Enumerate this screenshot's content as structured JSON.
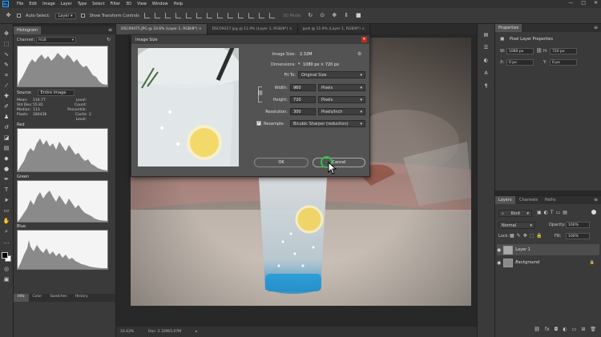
{
  "menubar": {
    "logo": "Ps",
    "items": [
      "File",
      "Edit",
      "Image",
      "Layer",
      "Type",
      "Select",
      "Filter",
      "3D",
      "View",
      "Window",
      "Help"
    ],
    "window_controls": [
      "—",
      "□",
      "✕"
    ]
  },
  "options_bar": {
    "auto_select_label": "Auto-Select:",
    "auto_select_value": "Layer",
    "show_transform_label": "Show Transform Controls",
    "mode_3d": "3D Mode:"
  },
  "histogram": {
    "tab_label": "Histogram",
    "channel_label": "Channel:",
    "channel_value": "RGB",
    "source_label": "Source:",
    "source_value": "Entire Image",
    "stats": {
      "mean_label": "Mean:",
      "mean_value": "116.77",
      "std_label": "Std Dev:",
      "std_value": "55.81",
      "median_label": "Median:",
      "median_value": "113",
      "pixels_label": "Pixels:",
      "pixels_value": "184436",
      "level_label": "Level:",
      "level_value": "",
      "count_label": "Count:",
      "count_value": "",
      "percentile_label": "Percentile:",
      "percentile_value": "",
      "cache_label": "Cache Level:",
      "cache_value": "2"
    },
    "red_label": "Red",
    "green_label": "Green",
    "blue_label": "Blue"
  },
  "bottom_tabs": [
    "Info",
    "Color",
    "Swatches",
    "History"
  ],
  "doc_tabs": [
    {
      "label": "DSC09475.JPG @ 33.6% (Layer 1, RGB/8*)",
      "close": "×"
    },
    {
      "label": "DSC09227.jpg @ 11.9% (Layer 1, RGB/8*)",
      "close": "×"
    },
    {
      "label": "goal @ 11.9% (Layer 1, RGB/8*)",
      "close": "×"
    }
  ],
  "status_bar": {
    "zoom": "33.43%",
    "doc": "Doc: 2.32M/5.07M"
  },
  "dialog": {
    "title": "Image Size",
    "image_size_label": "Image Size:",
    "image_size_value": "2.32M",
    "dimensions_label": "Dimensions:",
    "dimensions_value": "1080 px × 720 px",
    "fit_to_label": "Fit To:",
    "fit_to_value": "Original Size",
    "width_label": "Width:",
    "width_value": "960",
    "width_unit": "Pixels",
    "height_label": "Height:",
    "height_value": "720",
    "height_unit": "Pixels",
    "resolution_label": "Resolution:",
    "resolution_value": "300",
    "resolution_unit": "Pixels/Inch",
    "resample_label": "Resample:",
    "resample_value": "Bicubic Sharper (reduction)",
    "ok_label": "OK",
    "cancel_label": "Cancel"
  },
  "properties": {
    "tab_label": "Properties",
    "title": "Pixel Layer Properties",
    "w_label": "W:",
    "w_value": "1080 px",
    "h_label": "H:",
    "h_value": "720 px",
    "x_label": "X:",
    "x_value": "0 px",
    "y_label": "Y:",
    "y_value": "0 px"
  },
  "layers": {
    "tabs": [
      "Layers",
      "Channels",
      "Paths"
    ],
    "kind_value": "Kind",
    "blend_value": "Normal",
    "opacity_label": "Opacity:",
    "opacity_value": "100%",
    "lock_label": "Lock:",
    "fill_label": "Fill:",
    "fill_value": "100%",
    "items": [
      {
        "name": "Layer 1",
        "selected": true
      },
      {
        "name": "Background",
        "selected": false
      }
    ]
  },
  "colors": {
    "dialog_bg": "#535353",
    "panel_bg": "#3a3a3a",
    "accent": "#31a8ff",
    "cursor_ring": "#2fbf4a"
  }
}
